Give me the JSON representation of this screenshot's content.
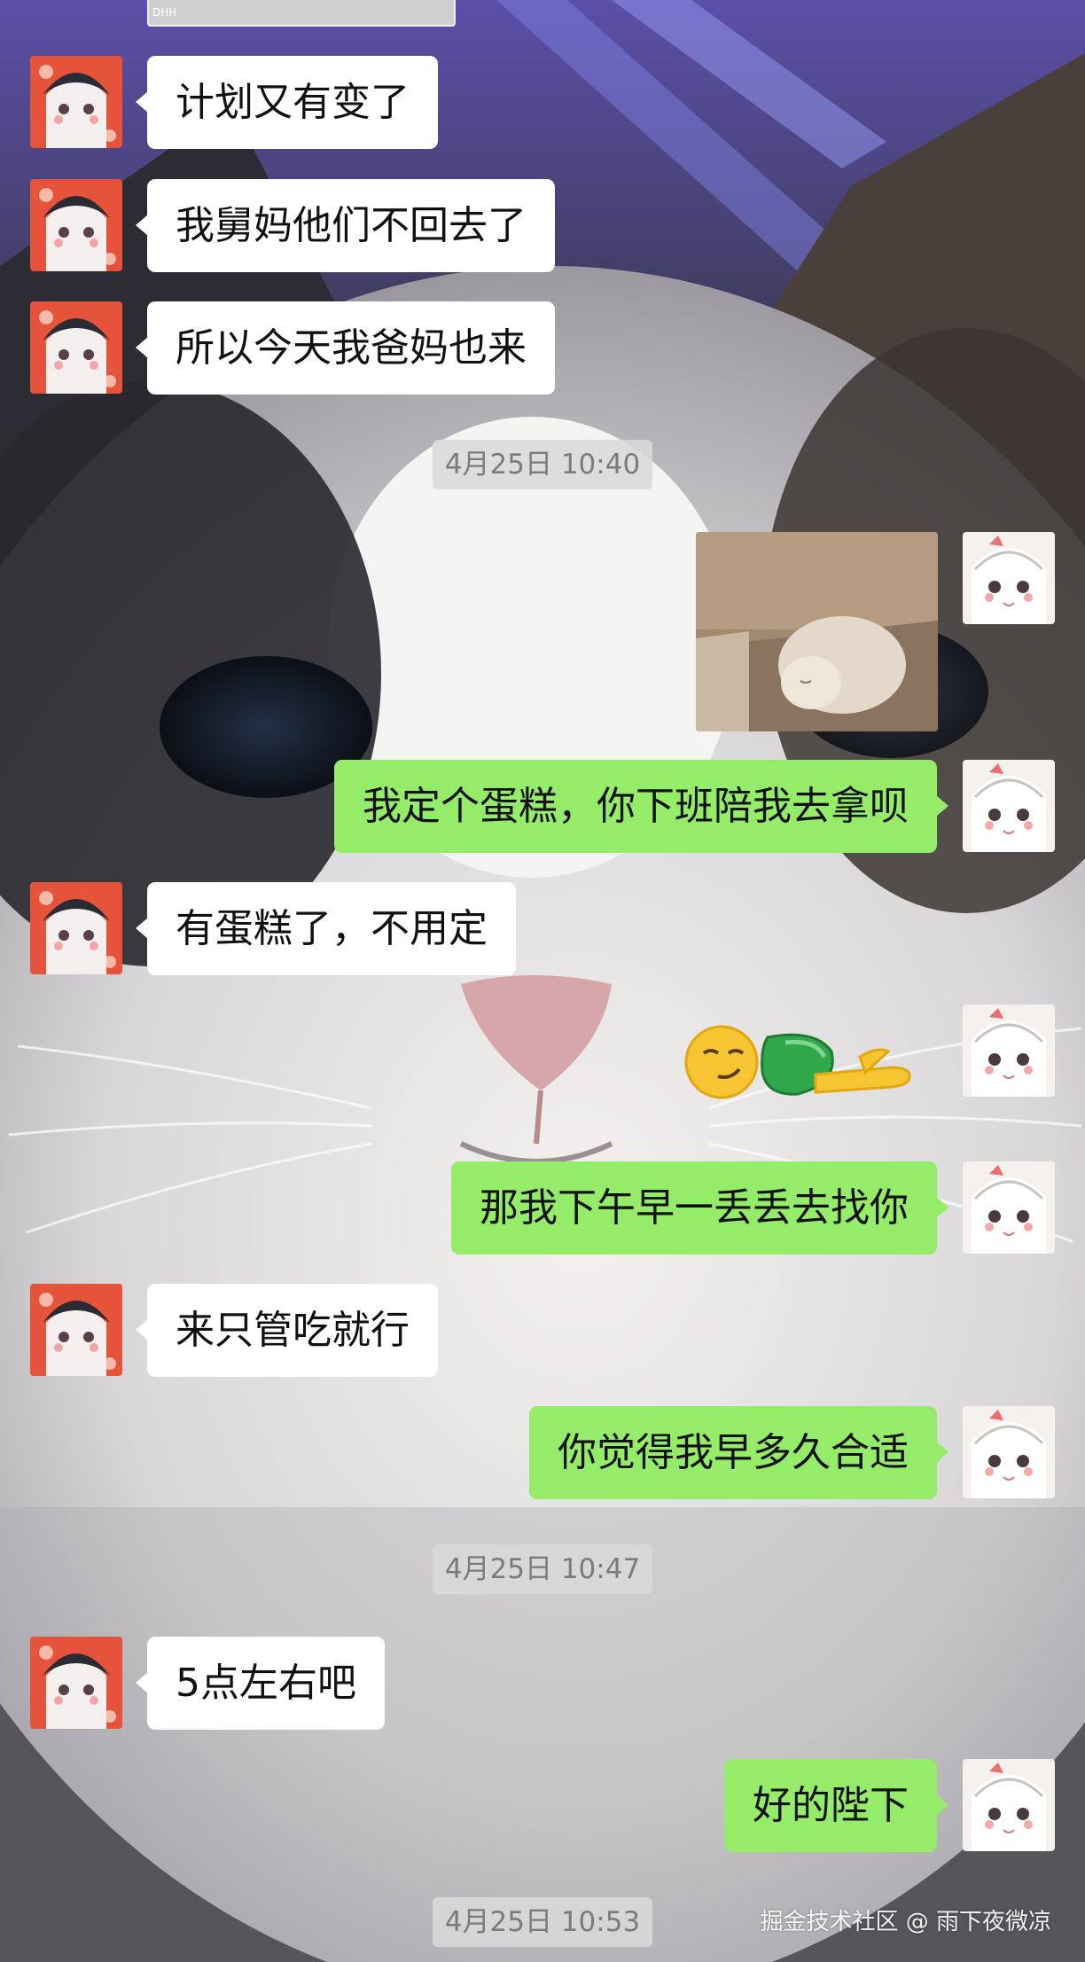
{
  "chat": {
    "messages": [
      {
        "side": "in",
        "text": "计划又有变了"
      },
      {
        "side": "in",
        "text": "我舅妈他们不回去了"
      },
      {
        "side": "in",
        "text": "所以今天我爸妈也来"
      },
      {
        "side": "out",
        "text": "我定个蛋糕，你下班陪我去拿呗"
      },
      {
        "side": "in",
        "text": "有蛋糕了，不用定"
      },
      {
        "side": "out",
        "text": "那我下午早一丢丢去找你"
      },
      {
        "side": "in",
        "text": "来只管吃就行"
      },
      {
        "side": "out",
        "text": "你觉得我早多久合适"
      },
      {
        "side": "in",
        "text": "5点左右吧"
      },
      {
        "side": "out",
        "text": "好的陛下"
      }
    ],
    "timestamps": [
      "4月25日 10:40",
      "4月25日 10:47",
      "4月25日 10:53"
    ],
    "top_image_caption": "DHH"
  },
  "watermark": "掘金技术社区 @ 雨下夜微凉",
  "icons": [
    "contact-avatar",
    "self-avatar",
    "smirk-emoji",
    "lying-flat-emoji",
    "sleeping-cat-photo"
  ],
  "colors": {
    "incoming_bubble": "#ffffff",
    "outgoing_bubble": "#95ec69",
    "timestamp_bg": "#dadada",
    "timestamp_text": "#7b7b7b"
  }
}
